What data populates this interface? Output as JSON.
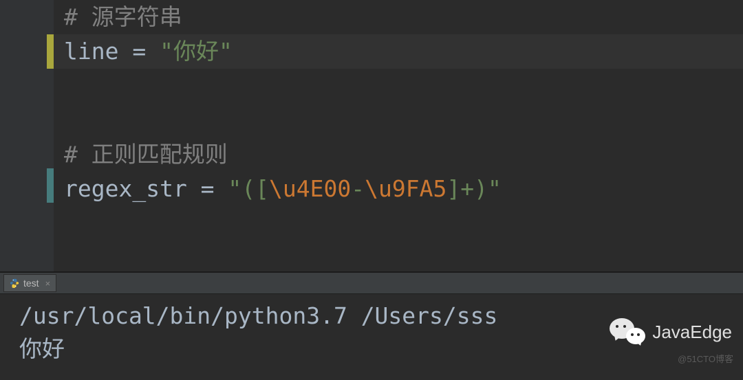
{
  "editor": {
    "lines": {
      "comment1": "# 源字符串",
      "assign1_var": "line",
      "assign1_eq": " = ",
      "assign1_str": "\"你好\"",
      "comment2": "# 正则匹配规则",
      "assign2_var": "regex_str",
      "assign2_eq": " = ",
      "assign2_q1": "\"",
      "assign2_p1": "([",
      "assign2_esc1": "\\u4E00",
      "assign2_dash": "-",
      "assign2_esc2": "\\u9FA5",
      "assign2_p2": "]+)",
      "assign2_q2": "\""
    }
  },
  "tab": {
    "name": "test"
  },
  "console": {
    "line1": "/usr/local/bin/python3.7 /Users/sss",
    "line2": "你好"
  },
  "watermark": {
    "text": "JavaEdge",
    "attribution": "@51CTO博客"
  }
}
